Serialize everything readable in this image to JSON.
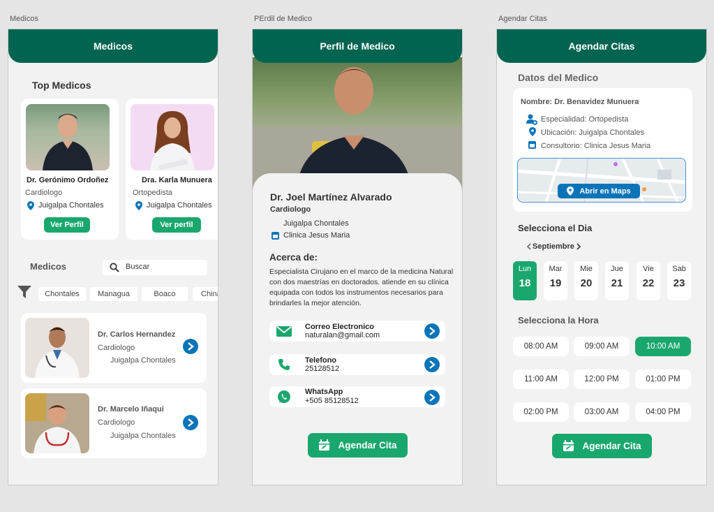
{
  "frames": {
    "left_label": "Medicos",
    "middle_label": "PErdil de Medico",
    "right_label": "Agendar Citas"
  },
  "list_screen": {
    "header_title": "Medicos",
    "top_title": "Top Medicos",
    "top_doctors": [
      {
        "name": "Dr. Gerónimo Ordoñez",
        "specialty": "Cardiologo",
        "location": "Juigalpa Chontales",
        "button": "Ver Perfil"
      },
      {
        "name": "Dra. Karla Munuera",
        "specialty": "Ortopedista",
        "location": "Juigalpa Chontales",
        "button": "Ver perfil"
      }
    ],
    "section_title": "Medicos",
    "search_placeholder": "Buscar",
    "filters": [
      "Chontales",
      "Managua",
      "Boaco",
      "China"
    ],
    "doctors": [
      {
        "name": "Dr. Carlos Hernandez",
        "specialty": "Cardiologo",
        "location": "Juigalpa Chontales"
      },
      {
        "name": "Dr. Marcelo Iñaqui",
        "specialty": "Cardiologo",
        "location": "Juigalpa Chontales"
      }
    ]
  },
  "profile_screen": {
    "header_title": "Perfil de Medico",
    "name": "Dr. Joel Martínez Alvarado",
    "specialty": "Cardiologo",
    "location": "Juigalpa Chontales",
    "clinic": "Clinica Jesus Maria",
    "about_title": "Acerca de:",
    "about_text": "Especialista Cirujano en el marco de la medicina Natural con dos maestrías en doctorados. atiende en su clínica equipada con todos los instrumentos necesarios para brindarles la mejor atención.",
    "contacts": [
      {
        "label": "Correo Electronico",
        "value": "naturalan@gmail.com",
        "icon": "mail-icon"
      },
      {
        "label": "Telefono",
        "value": "25128512",
        "icon": "phone-icon"
      },
      {
        "label": "WhatsApp",
        "value": "+505 85128512",
        "icon": "whatsapp-icon"
      }
    ],
    "cta": "Agendar Cita"
  },
  "schedule_screen": {
    "header_title": "Agendar Citas",
    "doctor_section": "Datos del Medico",
    "doctor_name": "Nombre: Dr. Benavidez Munuera",
    "specialty": "Especialidad: Ortopedista",
    "location": "Ubicación: Juigalpa Chontales",
    "clinic": "Consultorio: Clinica Jesus Maria",
    "maps_button": "Abrir en Maps",
    "day_section": "Selecciona el Dia",
    "month": "Septiembre",
    "days": [
      {
        "name": "Lun",
        "num": "18"
      },
      {
        "name": "Mar",
        "num": "19"
      },
      {
        "name": "Mie",
        "num": "20"
      },
      {
        "name": "Jue",
        "num": "21"
      },
      {
        "name": "Vie",
        "num": "22"
      },
      {
        "name": "Sab",
        "num": "23"
      }
    ],
    "hour_section": "Selecciona la Hora",
    "times": [
      "08:00 AM",
      "09:00 AM",
      "10:00 AM",
      "11:00 AM",
      "12:00 PM",
      "01:00 PM",
      "02:00 PM",
      "03:00 AM",
      "04:00 PM"
    ],
    "selected_time": "10:00 AM",
    "cta": "Agendar Cita"
  },
  "colors": {
    "header": "#016451",
    "accent": "#1aa76e",
    "link_blue": "#0a74b8",
    "background": "#f2f2f2"
  }
}
